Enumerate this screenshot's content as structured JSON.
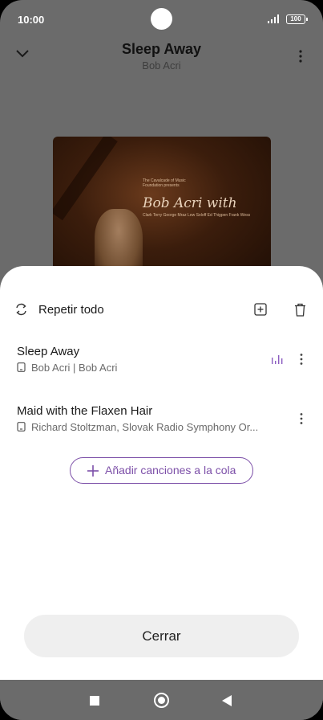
{
  "status_bar": {
    "time": "10:00",
    "battery": "100"
  },
  "player": {
    "title": "Sleep Away",
    "artist": "Bob Acri"
  },
  "album_art": {
    "small_text": "The Cavalcade of Music Foundation presents",
    "big_text": "Bob Acri with",
    "names_text": "Clark Terry George Mraz Lew Soloff Ed Thigpen Frank Wess"
  },
  "queue": {
    "repeat_label": "Repetir todo",
    "tracks": [
      {
        "name": "Sleep Away",
        "subtitle": "Bob Acri | Bob Acri",
        "playing": true
      },
      {
        "name": "Maid with the Flaxen Hair",
        "subtitle": "Richard Stoltzman, Slovak Radio Symphony Or...",
        "playing": false
      }
    ],
    "add_label": "Añadir canciones a la cola",
    "close_label": "Cerrar"
  },
  "colors": {
    "accent": "#7c4fa8",
    "dim_overlay": "#6b6b6b",
    "sheet_bg": "#ffffff"
  },
  "icons": {
    "chevron": "chevron-down-icon",
    "menu": "more-vertical-icon",
    "repeat": "repeat-icon",
    "add_queue": "add-to-queue-icon",
    "trash": "trash-icon",
    "device": "phone-device-icon",
    "equalizer": "equalizer-icon",
    "plus": "plus-icon"
  }
}
